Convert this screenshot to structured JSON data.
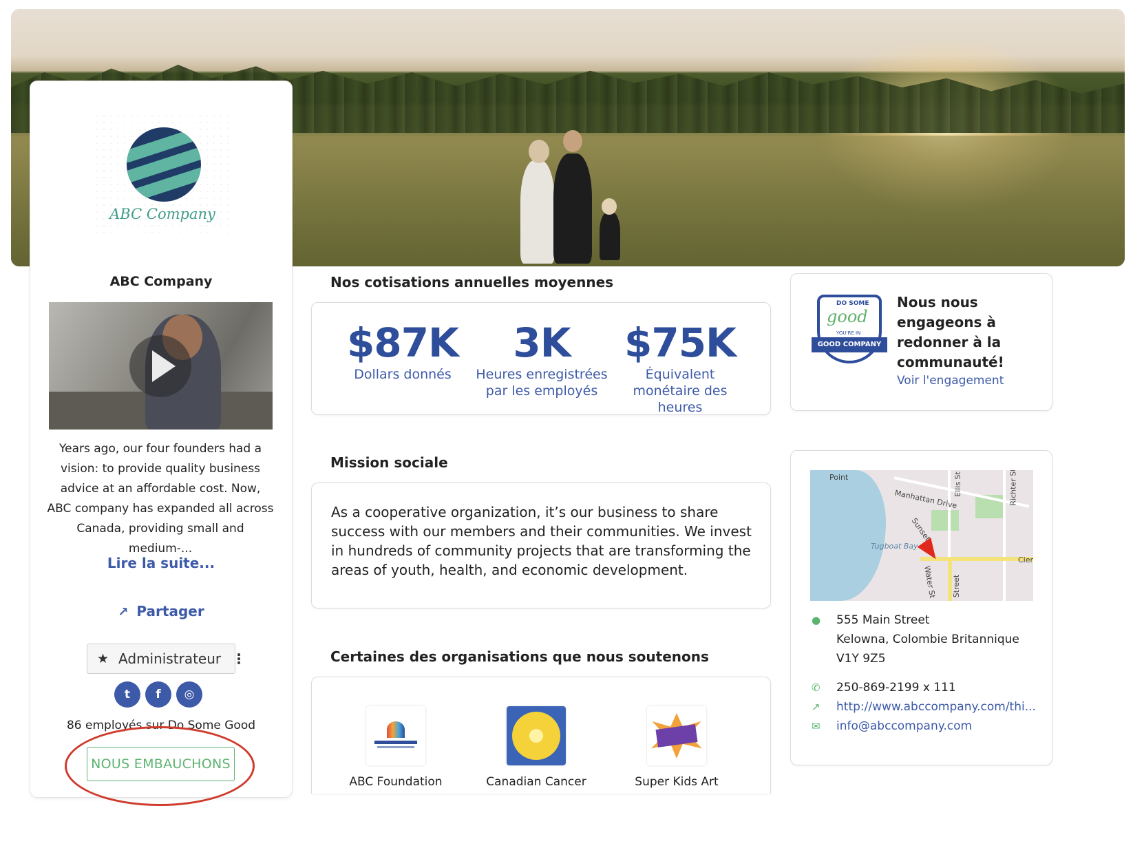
{
  "company": {
    "logo_text": "ABC Company",
    "name": "ABC Company",
    "description": "Years ago, our four founders had a vision: to provide quality business advice at an affordable cost. Now, ABC company has expanded all across Canada, providing small and medium-...",
    "read_more": "Lire la suite...",
    "share": "Partager",
    "admin_label": "Administrateur",
    "employees": "86 employés sur Do Some Good",
    "hiring_button": "NOUS EMBAUCHONS"
  },
  "socials": [
    {
      "icon": "twitter-icon",
      "glyph": "t"
    },
    {
      "icon": "facebook-icon",
      "glyph": "f"
    },
    {
      "icon": "instagram-icon",
      "glyph": "◎"
    }
  ],
  "contributions": {
    "title": "Nos cotisations annuelles moyennes",
    "stats": [
      {
        "value": "$87K",
        "label": "Dollars donnés"
      },
      {
        "value": "3K",
        "label": "Heures enregistrées par les employés"
      },
      {
        "value": "$75K",
        "label": "Équivalent monétaire des heures"
      }
    ]
  },
  "mission": {
    "title": "Mission sociale",
    "text": "As a cooperative organization, it’s our business to share success with our members and their communities. We invest in hundreds of community projects that are transforming the areas of youth, health, and economic development."
  },
  "organizations": {
    "title": "Certaines des organisations que nous soutenons",
    "items": [
      {
        "name": "ABC Foundation"
      },
      {
        "name": "Canadian Cancer"
      },
      {
        "name": "Super Kids Art"
      }
    ]
  },
  "engagement": {
    "badge_top": "DO SOME",
    "badge_script": "good",
    "badge_ribbon": "GOOD COMPANY",
    "badge_small": "YOU'RE IN",
    "text": "Nous nous engageons à redonner à la communauté!",
    "link": "Voir l'engagement"
  },
  "location": {
    "map_labels": [
      "Point",
      "Manhattan Drive",
      "Tugboat Bay",
      "Sunset",
      "Water St",
      "Street",
      "Ellis St",
      "Richter St",
      "Cler"
    ],
    "address_line1": "555 Main Street",
    "address_line2": "Kelowna, Colombie Britannique",
    "address_line3": "V1Y 9Z5",
    "phone": "250-869-2199 x 111",
    "website": "http://www.abccompany.com/thi...",
    "email": "info@abccompany.com"
  },
  "colors": {
    "accent_blue": "#3d5aa8",
    "stat_blue": "#2e4d9a",
    "hiring_green": "#5cb36f",
    "annotation_red": "#cf3b2c"
  }
}
